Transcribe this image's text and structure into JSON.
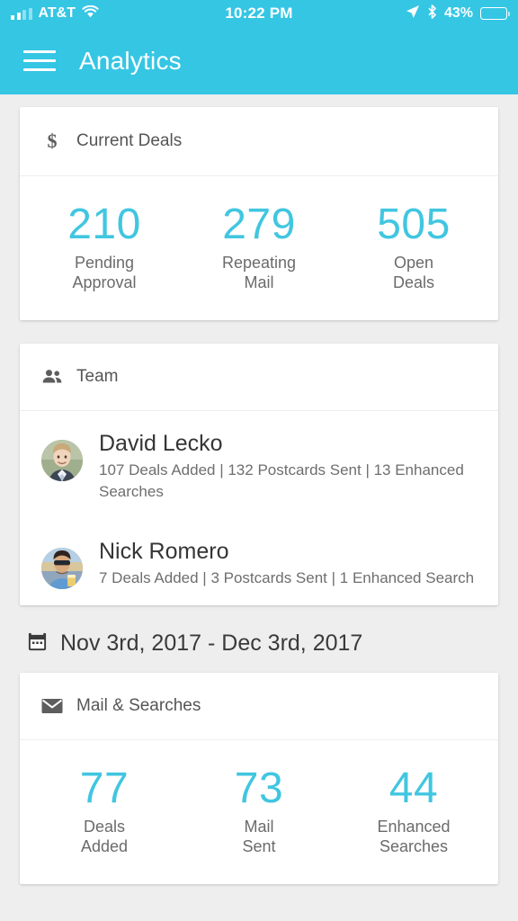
{
  "status_bar": {
    "carrier": "AT&T",
    "time": "10:22 PM",
    "battery_percent": "43%",
    "battery_level": 43,
    "icons": [
      "signal-bars-icon",
      "wifi-icon",
      "location-arrow-icon",
      "bluetooth-icon",
      "battery-icon"
    ]
  },
  "app_bar": {
    "title": "Analytics",
    "menu_icon": "hamburger-menu-icon",
    "background_color": "#35c6e4"
  },
  "theme": {
    "accent": "#35c6e4",
    "stat_number_color": "#41c6e0",
    "page_background": "#eeeeee",
    "card_background": "#ffffff"
  },
  "current_deals": {
    "title": "Current Deals",
    "icon": "dollar-sign-icon",
    "stats": [
      {
        "value": "210",
        "label_line1": "Pending",
        "label_line2": "Approval"
      },
      {
        "value": "279",
        "label_line1": "Repeating",
        "label_line2": "Mail"
      },
      {
        "value": "505",
        "label_line1": "Open",
        "label_line2": "Deals"
      }
    ]
  },
  "team": {
    "title": "Team",
    "icon": "people-group-icon",
    "members": [
      {
        "name": "David Lecko",
        "stats": "107 Deals Added | 132 Postcards Sent | 13 Enhanced Searches",
        "avatar": "avatar-david-lecko"
      },
      {
        "name": "Nick Romero",
        "stats": "7 Deals Added | 3 Postcards Sent | 1 Enhanced Search",
        "avatar": "avatar-nick-romero"
      }
    ]
  },
  "date_range": {
    "icon": "calendar-icon",
    "text": "Nov 3rd, 2017 - Dec 3rd, 2017"
  },
  "mail_and_searches": {
    "title": "Mail & Searches",
    "icon": "envelope-icon",
    "stats": [
      {
        "value": "77",
        "label_line1": "Deals",
        "label_line2": "Added"
      },
      {
        "value": "73",
        "label_line1": "Mail",
        "label_line2": "Sent"
      },
      {
        "value": "44",
        "label_line1": "Enhanced",
        "label_line2": "Searches"
      }
    ]
  }
}
